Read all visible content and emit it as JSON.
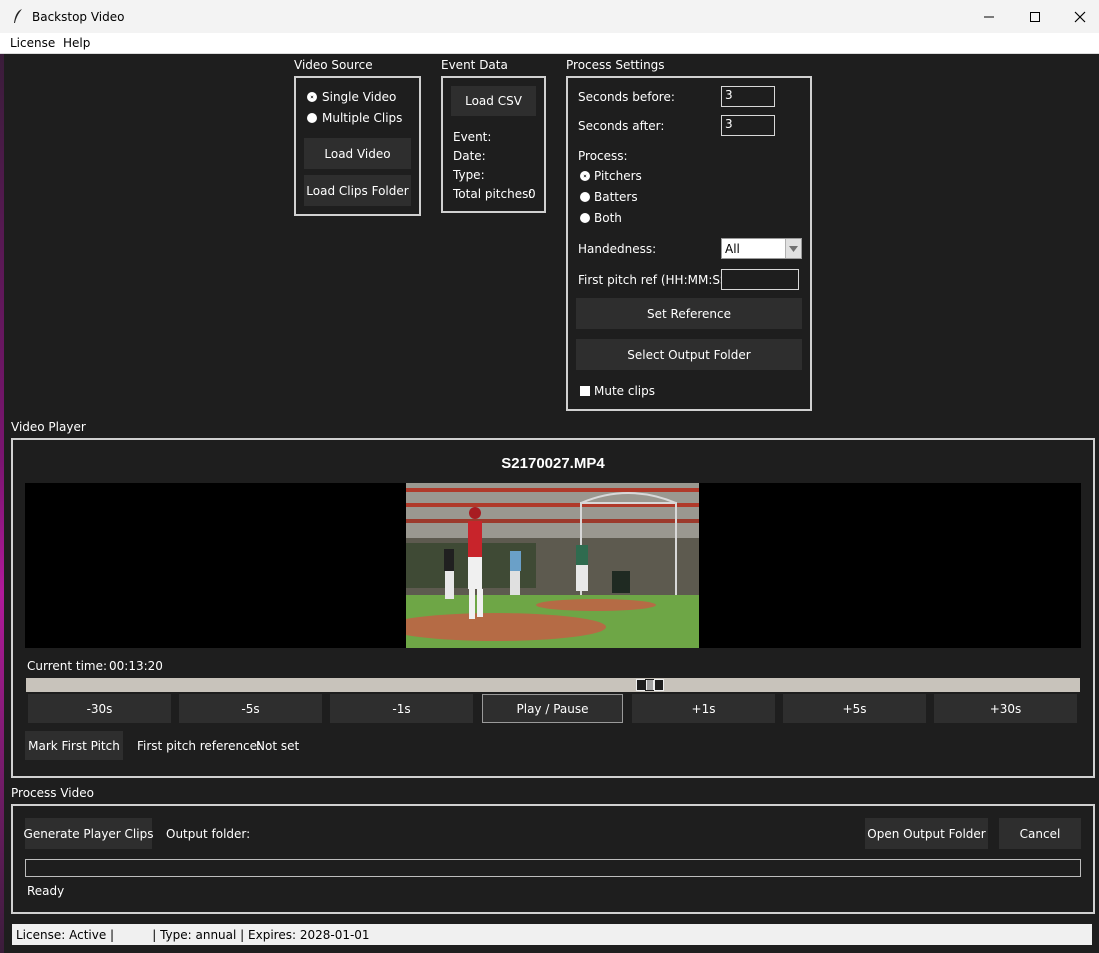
{
  "window": {
    "title": "Backstop Video",
    "controls": {
      "minimize": "minimize-icon",
      "maximize": "maximize-icon",
      "close": "close-icon"
    }
  },
  "menu": [
    "License",
    "Help"
  ],
  "video_source": {
    "title": "Video Source",
    "options": [
      {
        "label": "Single Video",
        "selected": true
      },
      {
        "label": "Multiple Clips",
        "selected": false
      }
    ],
    "load_video": "Load Video",
    "load_clips_folder": "Load Clips Folder"
  },
  "event_data": {
    "title": "Event Data",
    "load_csv": "Load CSV",
    "event_label": "Event:",
    "date_label": "Date:",
    "type_label": "Type:",
    "total_pitches_label": "Total pitches:",
    "total_pitches_value": "0"
  },
  "process_settings": {
    "title": "Process Settings",
    "seconds_before_label": "Seconds before:",
    "seconds_before_value": "3",
    "seconds_after_label": "Seconds after:",
    "seconds_after_value": "3",
    "process_label": "Process:",
    "process_options": [
      {
        "label": "Pitchers",
        "selected": true
      },
      {
        "label": "Batters",
        "selected": false
      },
      {
        "label": "Both",
        "selected": false
      }
    ],
    "handedness_label": "Handedness:",
    "handedness_value": "All",
    "first_pitch_ref_label": "First pitch ref (HH:MM:SS):",
    "first_pitch_ref_value": "",
    "set_reference": "Set Reference",
    "select_output_folder": "Select Output Folder",
    "mute_clips": "Mute clips",
    "mute_checked": false
  },
  "video_player": {
    "title": "Video Player",
    "filename": "S2170027.MP4",
    "current_time_label": "Current time:",
    "current_time_value": "00:13:20",
    "seek_position": 0.595,
    "controls": [
      "-30s",
      "-5s",
      "-1s",
      "Play / Pause",
      "+1s",
      "+5s",
      "+30s"
    ],
    "mark_first_pitch": "Mark First Pitch",
    "first_pitch_reference_label": "First pitch reference:",
    "first_pitch_reference_value": "Not set"
  },
  "process_video": {
    "title": "Process Video",
    "generate_player_clips": "Generate Player Clips",
    "output_folder_label": "Output folder:",
    "open_output_folder": "Open Output Folder",
    "cancel": "Cancel",
    "progress": 0,
    "status": "Ready"
  },
  "status_bar": "License: Active |          | Type: annual | Expires: 2028-01-01"
}
